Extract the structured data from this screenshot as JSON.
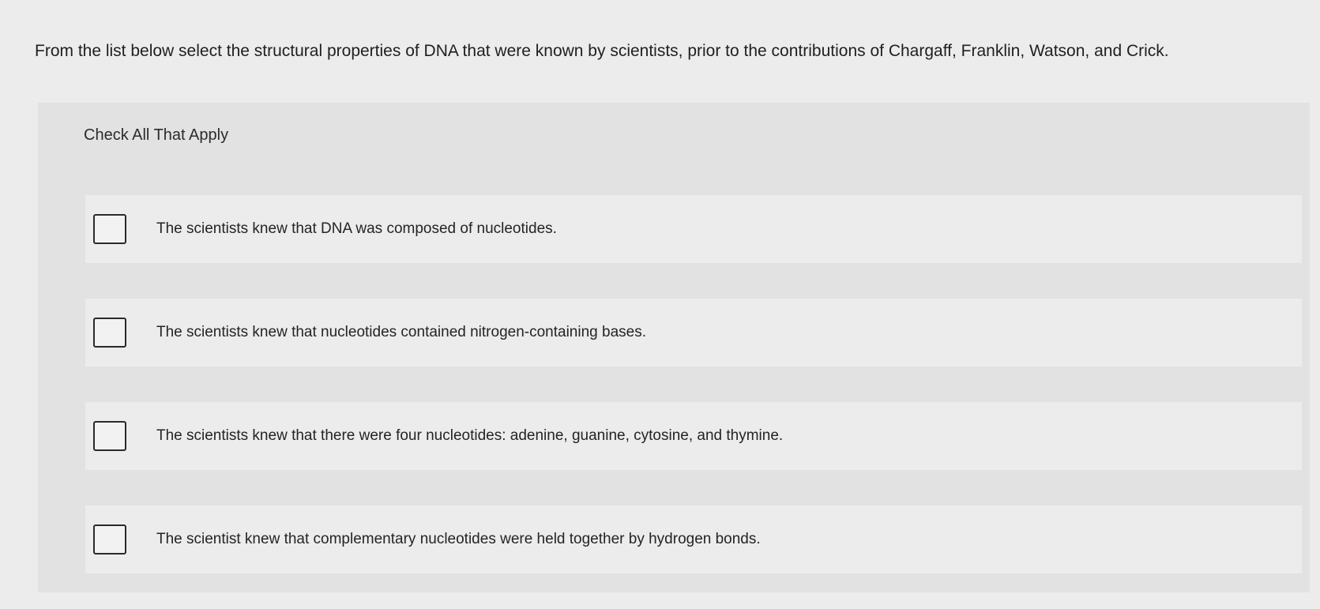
{
  "question": {
    "text": "From the list below select the structural properties of DNA that were known by scientists, prior to the contributions of Chargaff, Franklin, Watson, and Crick."
  },
  "panel": {
    "instructions": "Check All That Apply"
  },
  "options": [
    {
      "label": "The scientists knew that DNA was composed of nucleotides.",
      "checked": false
    },
    {
      "label": "The scientists knew that nucleotides contained nitrogen-containing bases.",
      "checked": false
    },
    {
      "label": "The scientists knew that there were four nucleotides: adenine, guanine, cytosine, and thymine.",
      "checked": false
    },
    {
      "label": "The scientist knew that complementary nucleotides were held together by hydrogen bonds.",
      "checked": false
    }
  ]
}
